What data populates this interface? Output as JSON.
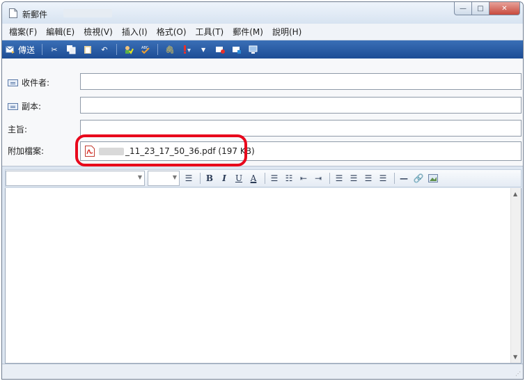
{
  "window": {
    "title": "新郵件"
  },
  "window_buttons": {
    "minimize": "—",
    "maximize": "□",
    "close": "✕"
  },
  "menu": [
    "檔案(F)",
    "編輯(E)",
    "檢視(V)",
    "插入(I)",
    "格式(O)",
    "工具(T)",
    "郵件(M)",
    "說明(H)"
  ],
  "toolbar": {
    "send_label": "傳送"
  },
  "headers": {
    "to_label": "收件者:",
    "cc_label": "副本:",
    "subject_label": "主旨:",
    "attach_label": "附加檔案:"
  },
  "attachment": {
    "file_text": "_11_23_17_50_36.pdf (197 KB)"
  },
  "format_buttons": {
    "bold": "B",
    "italic": "I",
    "underline": "U",
    "font_color": "A"
  },
  "colors": {
    "toolbar_bg": "#2a5ea8",
    "highlight": "#e8081c"
  },
  "icons": [
    "new-mail-icon",
    "send-icon",
    "cut-icon",
    "copy-icon",
    "paste-icon",
    "undo-icon",
    "check-names-icon",
    "spelling-icon",
    "attach-icon",
    "priority-icon",
    "dropdown-icon",
    "sign-icon",
    "encrypt-icon",
    "offline-icon",
    "paragraph-style-icon",
    "numbered-list-icon",
    "bullet-list-icon",
    "decrease-indent-icon",
    "increase-indent-icon",
    "align-left-icon",
    "align-center-icon",
    "align-right-icon",
    "justify-icon",
    "horizontal-line-icon",
    "hyperlink-icon",
    "insert-picture-icon",
    "pdf-file-icon"
  ]
}
